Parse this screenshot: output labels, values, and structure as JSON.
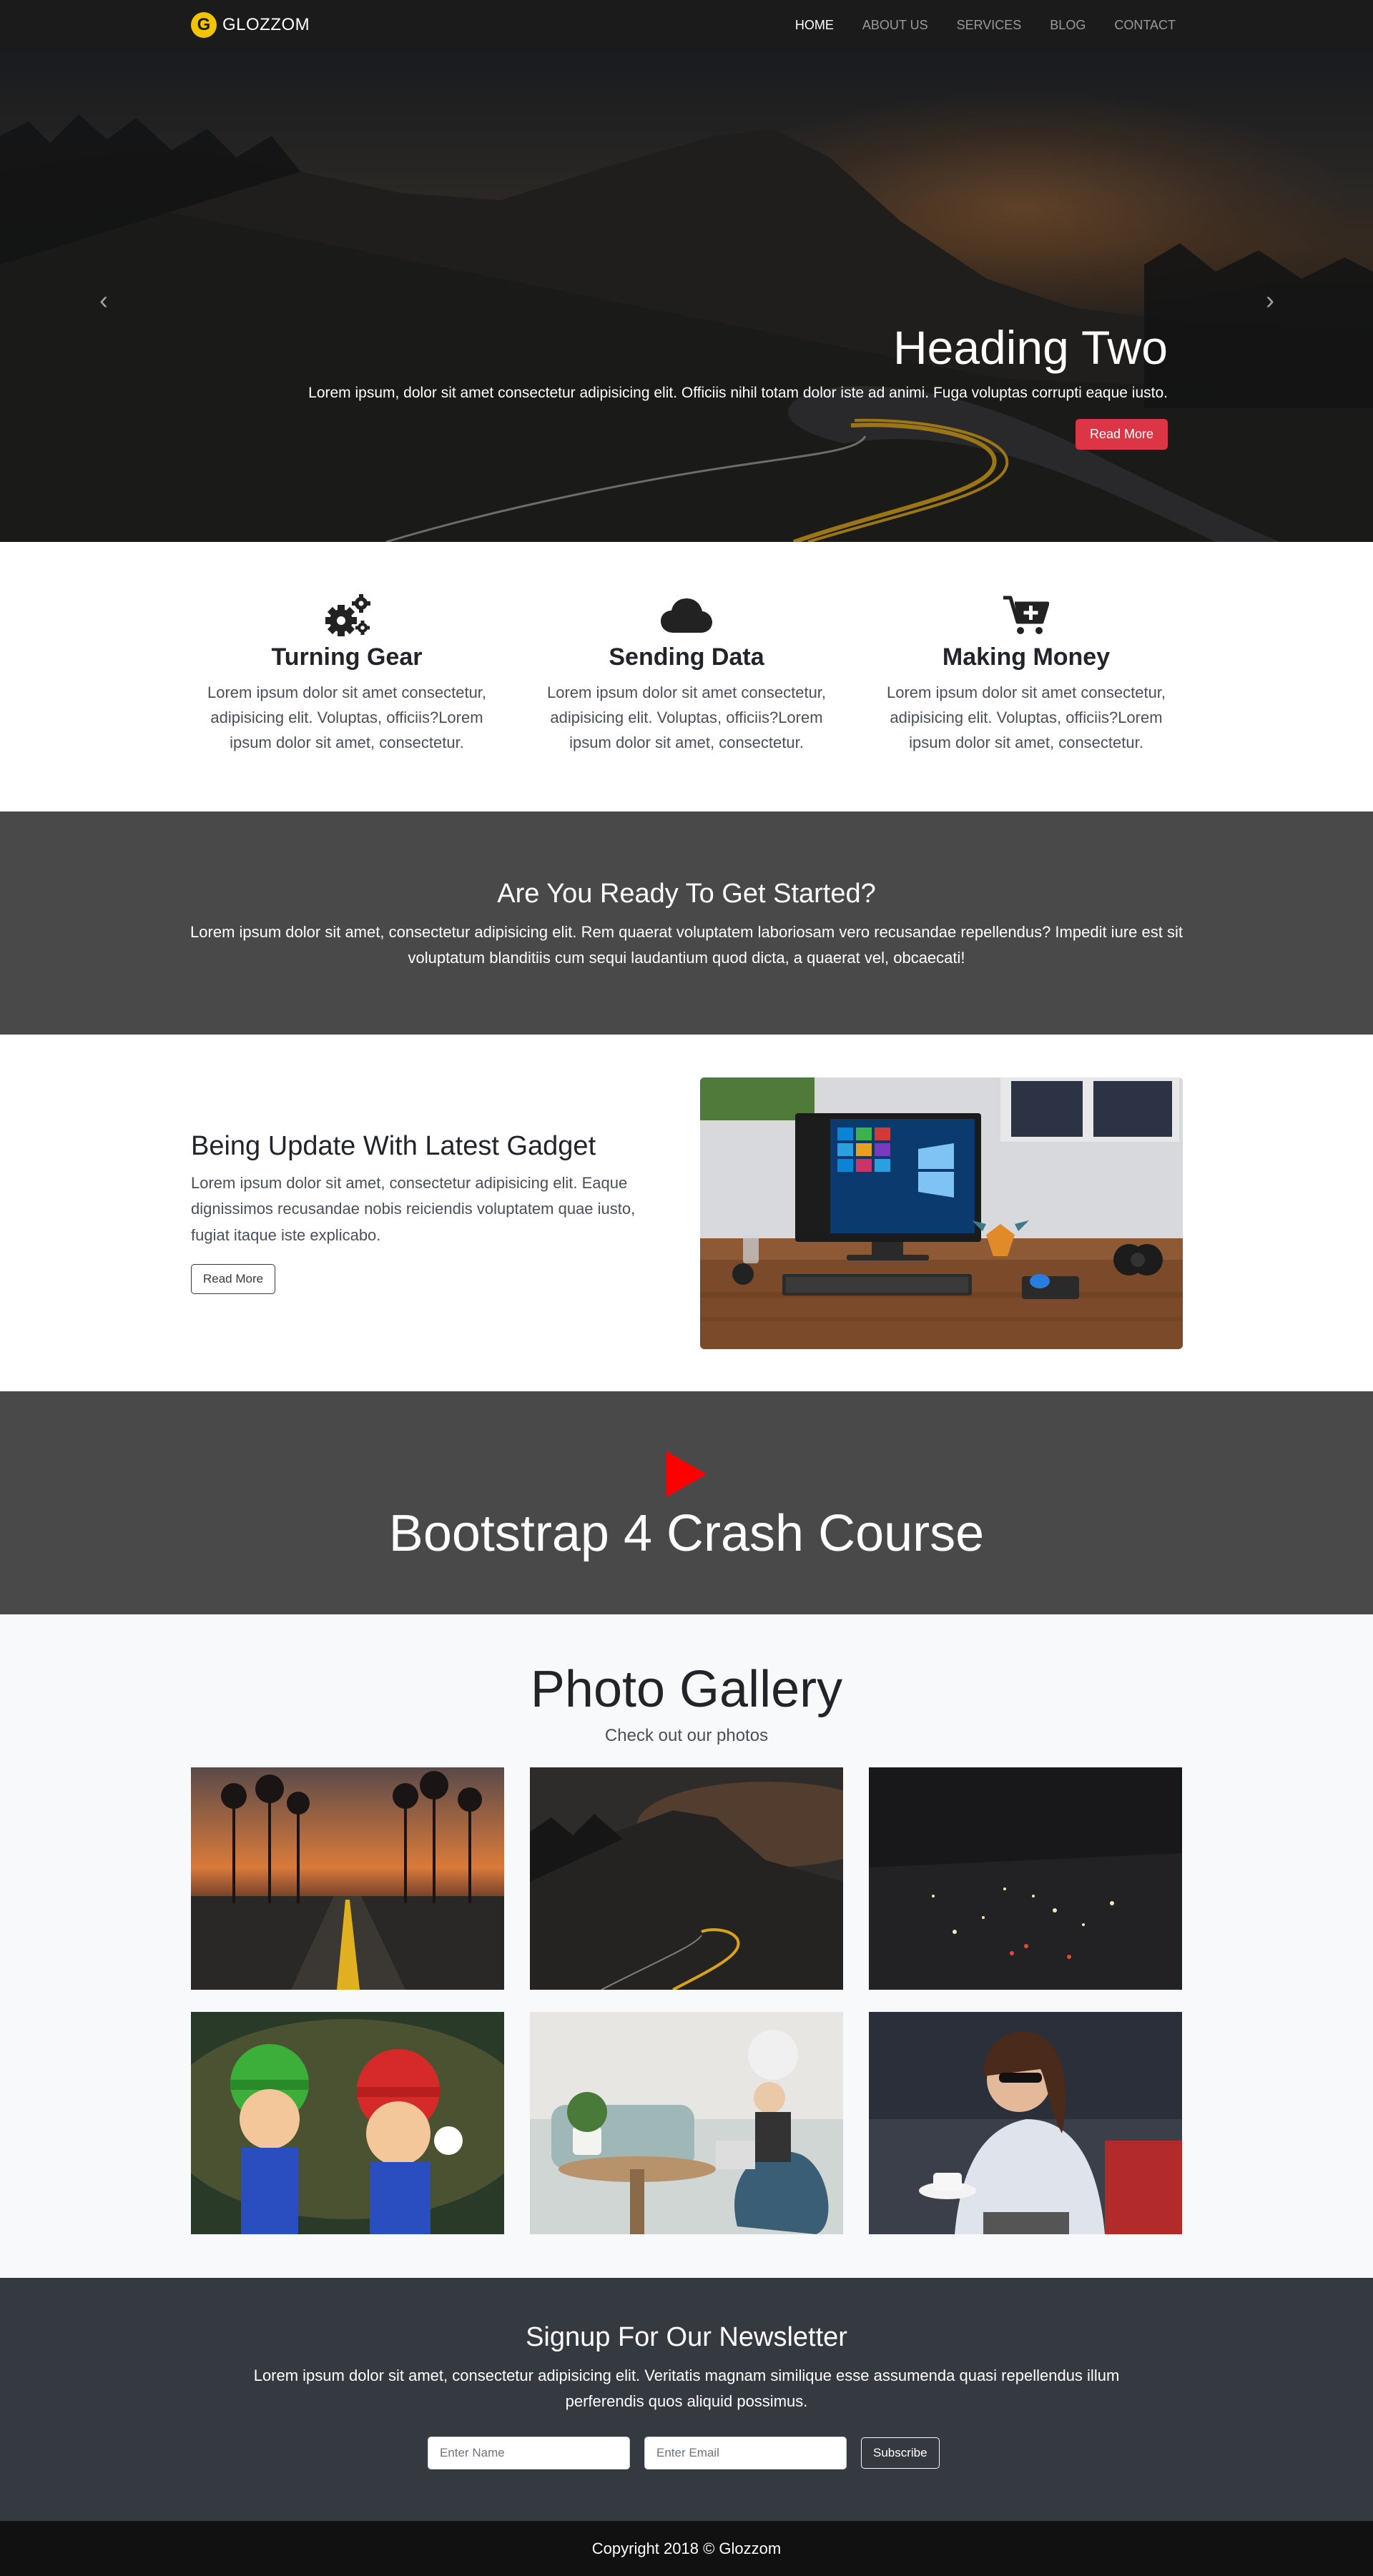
{
  "navbar": {
    "logo_letter": "G",
    "brand": "GLOZZOM",
    "links": [
      "HOME",
      "ABOUT US",
      "SERVICES",
      "BLOG",
      "CONTACT"
    ]
  },
  "hero": {
    "heading": "Heading Two",
    "text": "Lorem ipsum, dolor sit amet consectetur adipisicing elit. Officiis nihil totam dolor iste ad animi. Fuga voluptas corrupti eaque iusto.",
    "button": "Read More",
    "prev_icon": "chevron-left-icon",
    "next_icon": "chevron-right-icon",
    "indicator_count": 3,
    "active_indicator": 2
  },
  "features": [
    {
      "icon": "gears-icon",
      "title": "Turning Gear",
      "text": "Lorem ipsum dolor sit amet consectetur, adipisicing elit. Voluptas, officiis?Lorem ipsum dolor sit amet, consectetur."
    },
    {
      "icon": "cloud-icon",
      "title": "Sending Data",
      "text": "Lorem ipsum dolor sit amet consectetur, adipisicing elit. Voluptas, officiis?Lorem ipsum dolor sit amet, consectetur."
    },
    {
      "icon": "cart-plus-icon",
      "title": "Making Money",
      "text": "Lorem ipsum dolor sit amet consectetur, adipisicing elit. Voluptas, officiis?Lorem ipsum dolor sit amet, consectetur."
    }
  ],
  "get_started": {
    "heading": "Are You Ready To Get Started?",
    "text": "Lorem ipsum dolor sit amet, consectetur adipisicing elit. Rem quaerat voluptatem laboriosam vero recusandae repellendus? Impedit iure est sit voluptatum blanditiis cum sequi laudantium quod dicta, a quaerat vel, obcaecati!"
  },
  "gadget": {
    "heading": "Being Update With Latest Gadget",
    "text": "Lorem ipsum dolor sit amet, consectetur adipisicing elit. Eaque dignissimos recusandae nobis reiciendis voluptatem quae iusto, fugiat itaque iste explicabo.",
    "button": "Read More"
  },
  "video": {
    "heading": "Bootstrap 4 Crash Course",
    "play_icon": "play-icon",
    "play_color": "#ff0000"
  },
  "gallery": {
    "heading": "Photo Gallery",
    "subheading": "Check out our photos"
  },
  "newsletter": {
    "heading": "Signup For Our Newsletter",
    "text": "Lorem ipsum dolor sit amet, consectetur adipisicing elit. Veritatis magnam similique esse assumenda quasi repellendus illum perferendis quos aliquid possimus.",
    "name_placeholder": "Enter Name",
    "email_placeholder": "Enter Email",
    "button": "Subscribe"
  },
  "footer": {
    "copyright": "Copyright 2018 © Glozzom"
  },
  "colors": {
    "navbar_bg": "#1b1b1b",
    "logo_yellow": "#f2c400",
    "danger": "#dc3545",
    "dark_section": "#494949",
    "newsletter_bg": "#343a40"
  }
}
